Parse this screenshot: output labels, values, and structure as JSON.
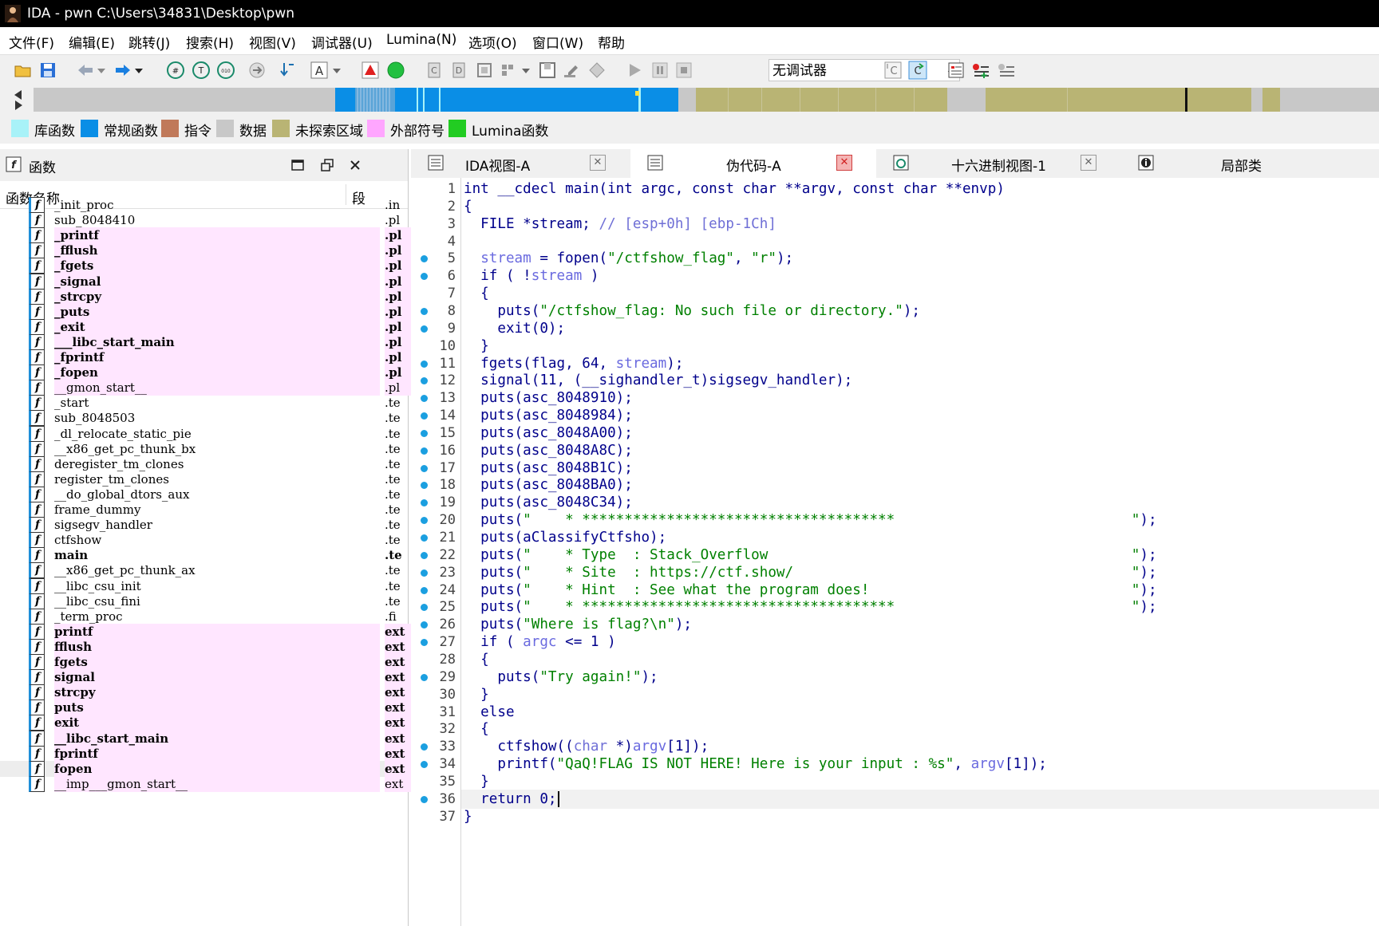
{
  "window": {
    "title": "IDA - pwn C:\\Users\\34831\\Desktop\\pwn"
  },
  "menu": [
    "文件(F)",
    "编辑(E)",
    "跳转(J)",
    "搜索(H)",
    "视图(V)",
    "调试器(U)",
    "Lumina(N)",
    "选项(O)",
    "窗口(W)",
    "帮助"
  ],
  "toolbar": {
    "debugger_select": "无调试器"
  },
  "legend": [
    {
      "label": "库函数",
      "color": "#a8f2f8"
    },
    {
      "label": "常规函数",
      "color": "#0a8ee6"
    },
    {
      "label": "指令",
      "color": "#c0795a"
    },
    {
      "label": "数据",
      "color": "#c8c8c8"
    },
    {
      "label": "未探索区域",
      "color": "#b9b474"
    },
    {
      "label": "外部符号",
      "color": "#ffa6ff"
    },
    {
      "label": "Lumina函数",
      "color": "#22cc22"
    }
  ],
  "functions_panel": {
    "title": "函数",
    "col_name": "函数名称",
    "col_segment": "段",
    "rows": [
      {
        "name": "_init_proc",
        "seg": ".in"
      },
      {
        "name": "sub_8048410",
        "seg": ".pl"
      },
      {
        "name": "_printf",
        "seg": ".pl"
      },
      {
        "name": "_fflush",
        "seg": ".pl"
      },
      {
        "name": "_fgets",
        "seg": ".pl"
      },
      {
        "name": "_signal",
        "seg": ".pl"
      },
      {
        "name": "_strcpy",
        "seg": ".pl"
      },
      {
        "name": "_puts",
        "seg": ".pl"
      },
      {
        "name": "_exit",
        "seg": ".pl"
      },
      {
        "name": "___libc_start_main",
        "seg": ".pl"
      },
      {
        "name": "_fprintf",
        "seg": ".pl"
      },
      {
        "name": "_fopen",
        "seg": ".pl"
      },
      {
        "name": "__gmon_start__",
        "seg": ".pl"
      },
      {
        "name": "_start",
        "seg": ".te"
      },
      {
        "name": "sub_8048503",
        "seg": ".te"
      },
      {
        "name": "_dl_relocate_static_pie",
        "seg": ".te"
      },
      {
        "name": "__x86_get_pc_thunk_bx",
        "seg": ".te"
      },
      {
        "name": "deregister_tm_clones",
        "seg": ".te"
      },
      {
        "name": "register_tm_clones",
        "seg": ".te"
      },
      {
        "name": "__do_global_dtors_aux",
        "seg": ".te"
      },
      {
        "name": "frame_dummy",
        "seg": ".te"
      },
      {
        "name": "sigsegv_handler",
        "seg": ".te"
      },
      {
        "name": "ctfshow",
        "seg": ".te"
      },
      {
        "name": "main",
        "seg": ".te"
      },
      {
        "name": "__x86_get_pc_thunk_ax",
        "seg": ".te"
      },
      {
        "name": "__libc_csu_init",
        "seg": ".te"
      },
      {
        "name": "__libc_csu_fini",
        "seg": ".te"
      },
      {
        "name": "_term_proc",
        "seg": ".fi"
      },
      {
        "name": "printf",
        "seg": "ext"
      },
      {
        "name": "fflush",
        "seg": "ext"
      },
      {
        "name": "fgets",
        "seg": "ext"
      },
      {
        "name": "signal",
        "seg": "ext"
      },
      {
        "name": "strcpy",
        "seg": "ext"
      },
      {
        "name": "puts",
        "seg": "ext"
      },
      {
        "name": "exit",
        "seg": "ext"
      },
      {
        "name": "__libc_start_main",
        "seg": "ext"
      },
      {
        "name": "fprintf",
        "seg": "ext"
      },
      {
        "name": "fopen",
        "seg": "ext"
      },
      {
        "name": "__imp___gmon_start__",
        "seg": "ext"
      }
    ]
  },
  "tabs": [
    {
      "label": "IDA视图-A"
    },
    {
      "label": "伪代码-A"
    },
    {
      "label": "十六进制视图-1"
    },
    {
      "label": "局部类"
    }
  ],
  "pseudocode": {
    "lines": [
      {
        "n": "1",
        "text": "int __cdecl main(int argc, const char **argv, const char **envp)"
      },
      {
        "n": "2",
        "text": "{"
      },
      {
        "n": "3",
        "text": "  FILE *stream; // [esp+0h] [ebp-1Ch]"
      },
      {
        "n": "4",
        "text": ""
      },
      {
        "n": "5",
        "text": "  stream = fopen(\"/ctfshow_flag\", \"r\");"
      },
      {
        "n": "6",
        "text": "  if ( !stream )"
      },
      {
        "n": "7",
        "text": "  {"
      },
      {
        "n": "8",
        "text": "    puts(\"/ctfshow_flag: No such file or directory.\");"
      },
      {
        "n": "9",
        "text": "    exit(0);"
      },
      {
        "n": "10",
        "text": "  }"
      },
      {
        "n": "11",
        "text": "  fgets(flag, 64, stream);"
      },
      {
        "n": "12",
        "text": "  signal(11, (__sighandler_t)sigsegv_handler);"
      },
      {
        "n": "13",
        "text": "  puts(asc_8048910);"
      },
      {
        "n": "14",
        "text": "  puts(asc_8048984);"
      },
      {
        "n": "15",
        "text": "  puts(asc_8048A00);"
      },
      {
        "n": "16",
        "text": "  puts(asc_8048A8C);"
      },
      {
        "n": "17",
        "text": "  puts(asc_8048B1C);"
      },
      {
        "n": "18",
        "text": "  puts(asc_8048BA0);"
      },
      {
        "n": "19",
        "text": "  puts(asc_8048C34);"
      },
      {
        "n": "20",
        "text": "  puts(\"    * *************************************                            \");"
      },
      {
        "n": "21",
        "text": "  puts(aClassifyCtfsho);"
      },
      {
        "n": "22",
        "text": "  puts(\"    * Type  : Stack_Overflow                                           \");"
      },
      {
        "n": "23",
        "text": "  puts(\"    * Site  : https://ctf.show/                                        \");"
      },
      {
        "n": "24",
        "text": "  puts(\"    * Hint  : See what the program does!                               \");"
      },
      {
        "n": "25",
        "text": "  puts(\"    * *************************************                            \");"
      },
      {
        "n": "26",
        "text": "  puts(\"Where is flag?\\n\");"
      },
      {
        "n": "27",
        "text": "  if ( argc <= 1 )"
      },
      {
        "n": "28",
        "text": "  {"
      },
      {
        "n": "29",
        "text": "    puts(\"Try again!\");"
      },
      {
        "n": "30",
        "text": "  }"
      },
      {
        "n": "31",
        "text": "  else"
      },
      {
        "n": "32",
        "text": "  {"
      },
      {
        "n": "33",
        "text": "    ctfshow((char *)argv[1]);"
      },
      {
        "n": "34",
        "text": "    printf(\"QaQ!FLAG IS NOT HERE! Here is your input : %s\", argv[1]);"
      },
      {
        "n": "35",
        "text": "  }"
      },
      {
        "n": "36",
        "text": "  return 0;"
      },
      {
        "n": "37",
        "text": "}"
      }
    ]
  }
}
